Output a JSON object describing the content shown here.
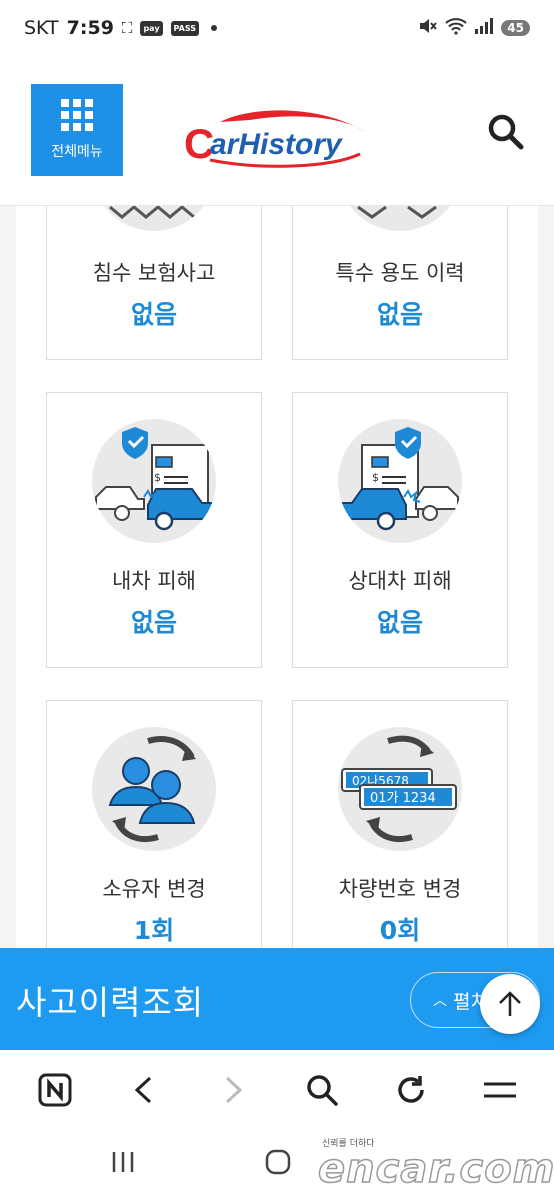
{
  "status_bar": {
    "carrier": "SKT",
    "time": "7:59",
    "badge_pay": "pay",
    "badge_pass": "PASS",
    "battery": "45"
  },
  "header": {
    "menu_label": "전체메뉴",
    "logo_text": "CarHistory",
    "logo_colors": {
      "primary": "#e4232b",
      "secondary": "#1e5fb0"
    }
  },
  "cards": [
    {
      "title": "침수 보험사고",
      "value": "없음"
    },
    {
      "title": "특수 용도 이력",
      "value": "없음"
    },
    {
      "title": "내차 피해",
      "value": "없음",
      "icon": "own-car-damage-illustration"
    },
    {
      "title": "상대차 피해",
      "value": "없음",
      "icon": "other-car-damage-illustration"
    },
    {
      "title": "소유자 변경",
      "value": "1회",
      "icon": "owner-change-illustration"
    },
    {
      "title": "차량번호 변경",
      "value": "0회",
      "icon": "plate-change-illustration"
    }
  ],
  "plate": {
    "old": "02나5678",
    "new": "01가 1234"
  },
  "banner": {
    "title": "사고이력조회",
    "expand_label": "펼치"
  },
  "watermark": {
    "tagline": "신뢰를 더하다",
    "brand": "encar.com"
  },
  "colors": {
    "accent": "#1e9af0",
    "value_blue": "#1e8ad6",
    "menu_blue": "#1e90e8"
  }
}
